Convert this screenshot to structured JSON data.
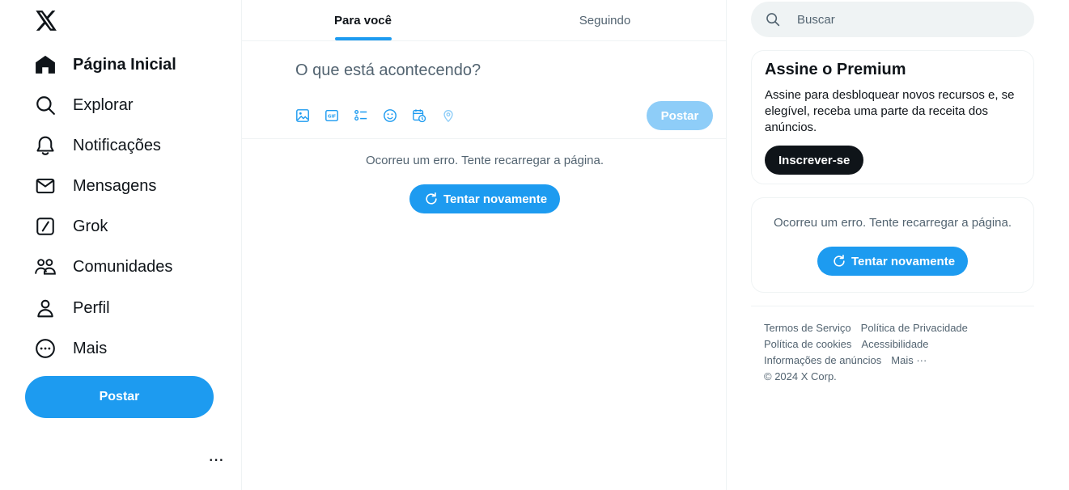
{
  "sidebar": {
    "logo": "x-logo-icon",
    "items": [
      {
        "label": "Página Inicial",
        "icon": "home-icon",
        "active": true
      },
      {
        "label": "Explorar",
        "icon": "search-icon"
      },
      {
        "label": "Notificações",
        "icon": "bell-icon"
      },
      {
        "label": "Mensagens",
        "icon": "mail-icon"
      },
      {
        "label": "Grok",
        "icon": "grok-icon"
      },
      {
        "label": "Comunidades",
        "icon": "communities-icon"
      },
      {
        "label": "Perfil",
        "icon": "person-icon"
      },
      {
        "label": "Mais",
        "icon": "more-circle-icon"
      }
    ],
    "post_label": "Postar",
    "more_label": "···"
  },
  "main": {
    "tabs": [
      {
        "label": "Para você",
        "active": true
      },
      {
        "label": "Seguindo"
      }
    ],
    "composer": {
      "placeholder": "O que está acontecendo?",
      "tools": [
        "image-icon",
        "gif-icon",
        "poll-icon",
        "emoji-icon",
        "schedule-icon",
        "location-icon"
      ],
      "post_label": "Postar"
    },
    "error": {
      "message": "Ocorreu um erro. Tente recarregar a página.",
      "retry_label": "Tentar novamente"
    }
  },
  "right": {
    "search_placeholder": "Buscar",
    "premium": {
      "title": "Assine o Premium",
      "body": "Assine para desbloquear novos recursos e, se elegível, receba uma parte da receita dos anúncios.",
      "button": "Inscrever-se"
    },
    "error": {
      "message": "Ocorreu um erro. Tente recarregar a página.",
      "retry_label": "Tentar novamente"
    },
    "footer": {
      "links": [
        [
          "Termos de Serviço",
          "Política de Privacidade"
        ],
        [
          "Política de cookies",
          "Acessibilidade"
        ],
        [
          "Informações de anúncios",
          "Mais ···"
        ]
      ],
      "copyright": "© 2024 X Corp."
    }
  },
  "colors": {
    "accent": "#1d9bf0",
    "accent_disabled": "#8ecdf8",
    "text_primary": "#0f1419",
    "text_secondary": "#536471",
    "border": "#eff3f4"
  }
}
